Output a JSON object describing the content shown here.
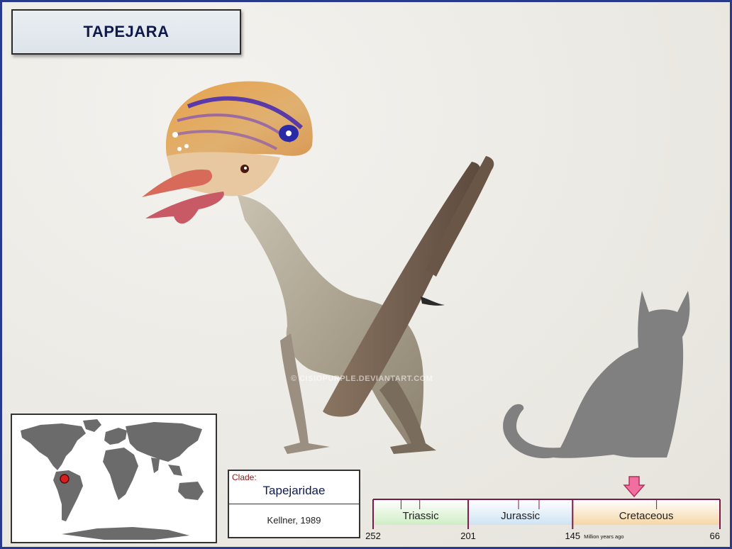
{
  "title": "TAPEJARA",
  "watermark": "© CISIOPURPLE.DEVIANTART.COM",
  "clade": {
    "label": "Clade:",
    "name": "Tapejaridae",
    "author": "Kellner, 1989"
  },
  "timeline": {
    "periods": [
      {
        "name": "Triassic",
        "start": 252,
        "end": 201,
        "color": "#cfeec5"
      },
      {
        "name": "Jurassic",
        "start": 201,
        "end": 145,
        "color": "#cfe3f3"
      },
      {
        "name": "Cretaceous",
        "start": 145,
        "end": 66,
        "color": "#f6d7a6"
      }
    ],
    "tick_labels": [
      "252",
      "201",
      "145",
      "66"
    ],
    "unit_label": "Million years ago",
    "marker_value": 112,
    "marker_color": "#f06fa0"
  },
  "colors": {
    "frame": "#2a3a8a",
    "title_text": "#0f1a4a",
    "silhouette": "#808080",
    "land": "#6b6b6b",
    "location_dot": "#d81e1e"
  },
  "icons": {
    "location": "location-dot-icon",
    "marker": "down-arrow-icon"
  }
}
